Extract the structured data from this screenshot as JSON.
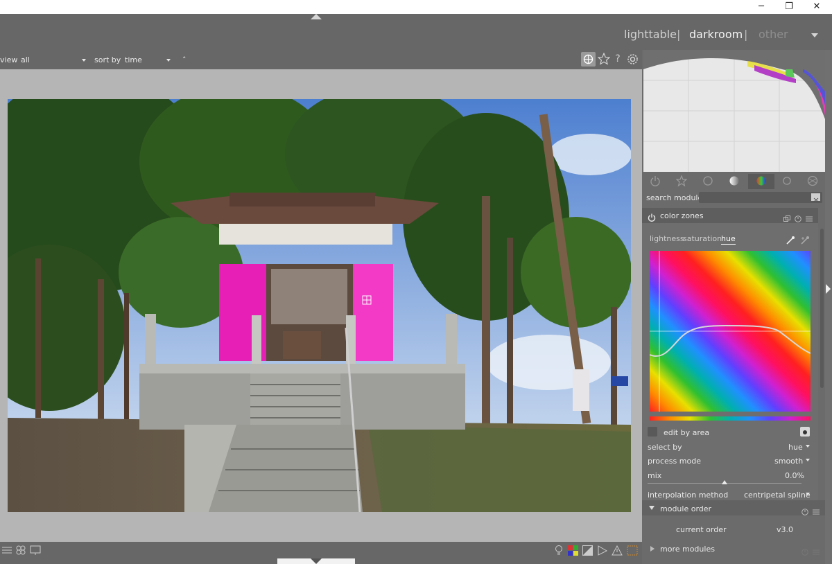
{
  "window": {
    "minimize_icon": "─",
    "restore_icon": "❐",
    "close_icon": "✕"
  },
  "views": {
    "lighttable": "lighttable",
    "separator": "|",
    "darkroom": "darkroom",
    "other": "other"
  },
  "filter": {
    "view_label": "view",
    "view_value": "all",
    "sort_label": "sort by",
    "sort_value": "time",
    "sort_order_icon": "˄"
  },
  "module_groups": [
    "power",
    "star",
    "circle",
    "tone",
    "color",
    "correct",
    "effect"
  ],
  "search": {
    "label": "search module",
    "placeholder": ""
  },
  "color_zones": {
    "title": "color zones",
    "tabs": [
      "lightness",
      "saturation",
      "hue"
    ],
    "active_tab": "hue",
    "edit_by_area": "edit by area",
    "select_by_label": "select by",
    "select_by_value": "hue",
    "process_mode_label": "process mode",
    "process_mode_value": "smooth",
    "mix_label": "mix",
    "mix_value": "0.0%",
    "mix_fraction": 0.5,
    "interpolation_label": "interpolation method",
    "interpolation_value": "centripetal spline"
  },
  "module_order": {
    "title": "module order",
    "current_label": "current order",
    "current_value": "v3.0"
  },
  "more_modules": {
    "title": "more modules"
  },
  "colors": {
    "accent": "#e6e6e6",
    "active_group": "#55aa55",
    "magenta": "#ff22cc"
  }
}
